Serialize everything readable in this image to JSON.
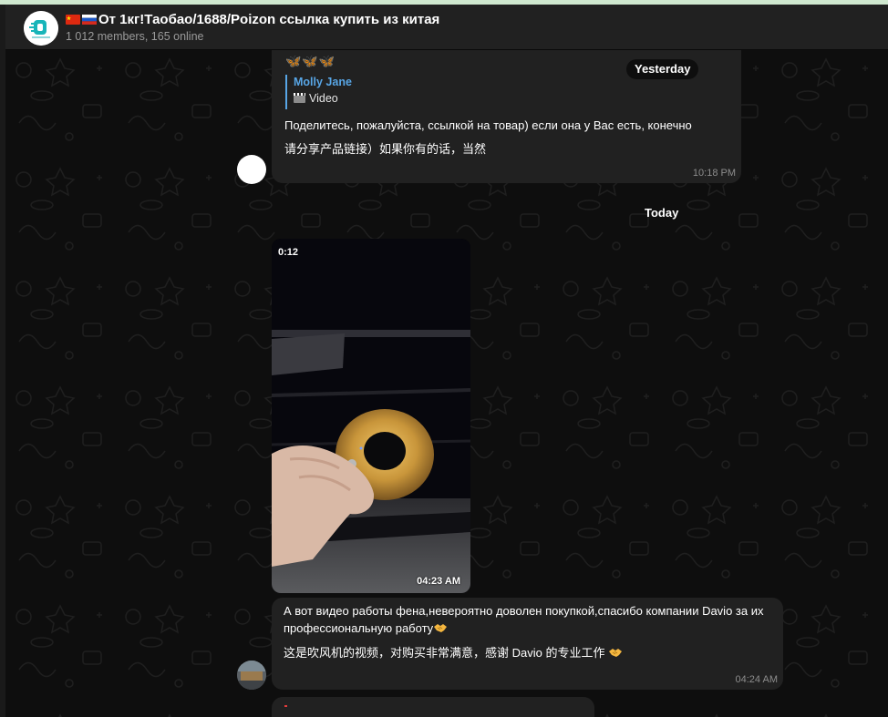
{
  "header": {
    "title": "От 1кг!Таобао/1688/Poizon ссылка купить из китая",
    "subtitle": "1 012 members, 165 online"
  },
  "messages": [
    {
      "emojis": "🦋🦋🦋",
      "reply_name": "Molly Jane",
      "reply_text": "Video",
      "text_ru": "Поделитесь, пожалуйста,  ссылкой на товар) если она у Вас есть, конечно",
      "text_cn": "请分享产品链接）如果你有的话，当然",
      "time": "10:18 PM"
    },
    {
      "video_duration": "0:12",
      "time": "04:23 AM"
    },
    {
      "text_ru": "А вот видео работы фена,невероятно доволен покупкой,спасибо компании Davio за их профессиональную работу",
      "text_cn": "这是吹风机的视频，对购买非常满意，感谢 Davio 的专业工作",
      "time": "04:24 AM"
    }
  ],
  "date_separators": {
    "yesterday": "Yesterday",
    "today": "Today"
  },
  "colors": {
    "background": "#0e0e0e",
    "header": "#212121",
    "bubble": "#212121",
    "link": "#58a6e6",
    "emoji": "#4fb4f5"
  },
  "icons": {
    "reply": "clapper-board-icon",
    "emoji": "handshake-icon",
    "flags": [
      "china-flag-icon",
      "russia-flag-icon"
    ]
  }
}
